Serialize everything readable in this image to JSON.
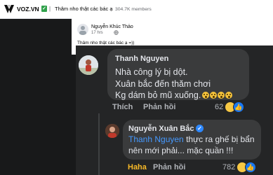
{
  "header": {
    "brand": "VOZ.VN",
    "verified_mark": "✓",
    "separator": "|",
    "group_name": "Thâm nho thật các bác ạ",
    "dot": "·",
    "members": "304.7K members"
  },
  "post": {
    "author": "Nguyễn Khúc Thảo",
    "time": "17 hrs",
    "text": "Thâm nho thật các bác ạ =))"
  },
  "comment": {
    "author": "Thanh Nguyen",
    "lines": [
      "Nhà công lý bị dột.",
      "Xuân bắc đến thăm chơi",
      "Kg dám bỏ mũ xuống."
    ],
    "like_label": "Thích",
    "reply_label": "Phản hồi",
    "reaction_count": "62"
  },
  "reply": {
    "author": "Nguyễn Xuân Bắc",
    "mention": "Thanh Nguyen",
    "line1_rest": " thực ra ghế bị bẩn",
    "line2": "nên mới phải... mặc quần !!!",
    "reaction_label": "Haha",
    "reply_label": "Phản hồi",
    "reaction_count": "782"
  },
  "icons": {
    "logo": "voz-logo-icon",
    "verified": "verified-check-icon",
    "globe": "globe-icon",
    "emoji": "astonished-emoji-icon",
    "haha": "haha-reaction-icon",
    "like": "like-reaction-icon"
  },
  "colors": {
    "dark_bg": "#242526",
    "bubble": "#3a3b3c",
    "mention": "#4599ff",
    "haha": "#f7b928",
    "like": "#1877f2"
  }
}
